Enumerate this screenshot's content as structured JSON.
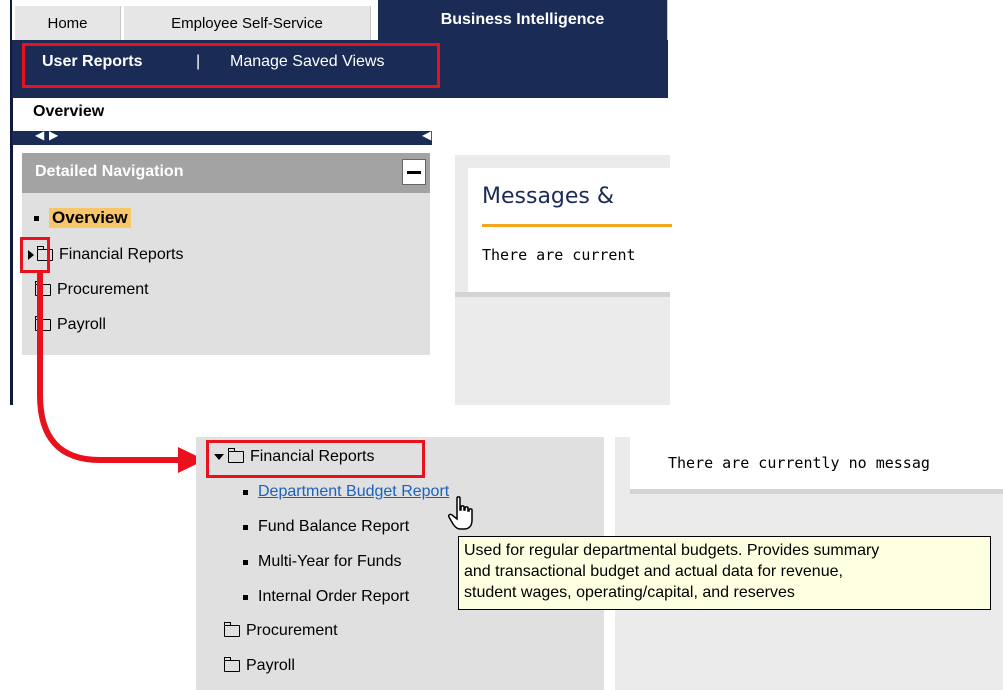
{
  "tabs": [
    "Home",
    "Employee Self-Service",
    "Business Intelligence"
  ],
  "subnav": {
    "user_reports": "User Reports",
    "separator": "|",
    "manage_saved_views": "Manage Saved Views"
  },
  "page_title": "Overview",
  "detailed_nav": {
    "title": "Detailed Navigation",
    "items": [
      "Overview",
      "Financial Reports",
      "Procurement",
      "Payroll"
    ]
  },
  "messages": {
    "title": "Messages &",
    "text": "There are current"
  },
  "expanded_nav": {
    "folder": "Financial Reports",
    "children": [
      "Department Budget Report",
      "Fund Balance Report",
      "Multi-Year for Funds",
      "Internal Order Report"
    ],
    "siblings": [
      "Procurement",
      "Payroll"
    ]
  },
  "messages_lower": {
    "text": "There are currently no messag"
  },
  "tooltip": [
    "Used for regular departmental budgets. Provides summary",
    "and transactional budget and actual data for revenue,",
    "student wages, operating/capital, and reserves"
  ],
  "colors": {
    "nav_dark": "#1a2b56",
    "highlight_red": "#e8121e",
    "overview_highlight": "#f7c56a",
    "link": "#1b62bd"
  }
}
